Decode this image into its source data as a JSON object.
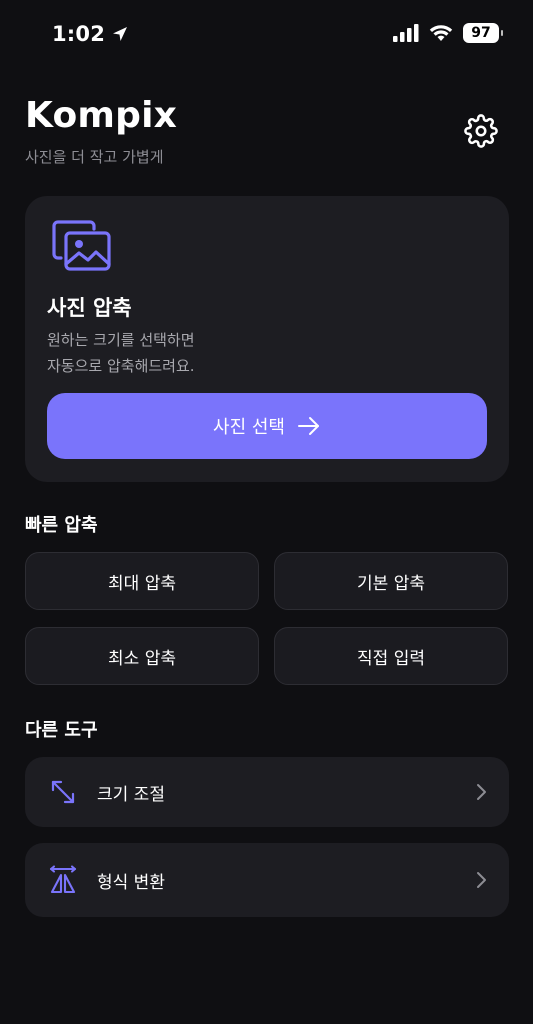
{
  "status_bar": {
    "time": "1:02",
    "battery": "97"
  },
  "header": {
    "title": "Kompix",
    "subtitle": "사진을 더 작고 가볍게"
  },
  "hero": {
    "title": "사진 압축",
    "desc_line1": "원하는 크기를 선택하면",
    "desc_line2": "자동으로 압축해드려요.",
    "button_label": "사진 선택"
  },
  "quick": {
    "section_title": "빠른 압축",
    "items": [
      {
        "label": "최대 압축"
      },
      {
        "label": "기본 압축"
      },
      {
        "label": "최소 압축"
      },
      {
        "label": "직접 입력"
      }
    ]
  },
  "tools": {
    "section_title": "다른 도구",
    "items": [
      {
        "label": "크기 조절",
        "icon": "resize-icon"
      },
      {
        "label": "형식 변환",
        "icon": "convert-icon"
      }
    ]
  },
  "colors": {
    "accent": "#7a74fb",
    "background": "#0f0f12",
    "card": "#1d1d22"
  }
}
